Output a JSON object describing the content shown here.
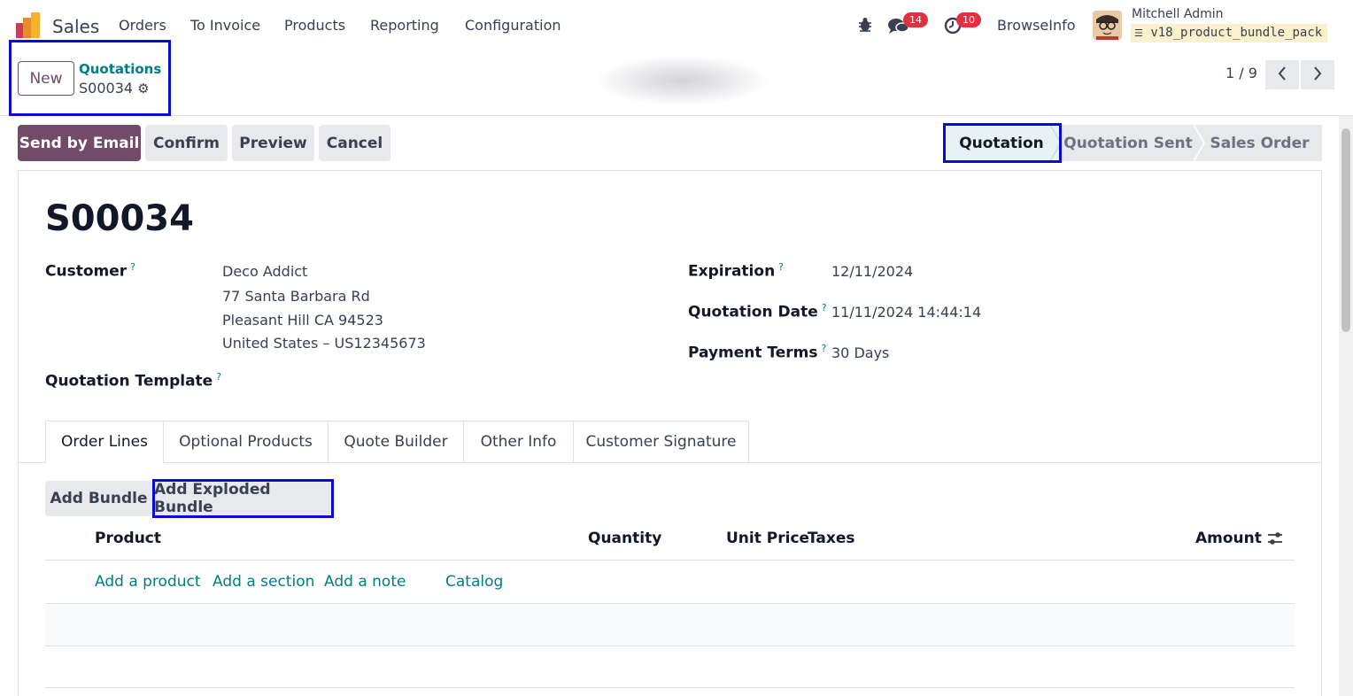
{
  "navbar": {
    "app_name": "Sales",
    "menus": [
      "Orders",
      "To Invoice",
      "Products",
      "Reporting",
      "Configuration"
    ],
    "messages_count": "14",
    "activities_count": "10",
    "company": "BrowseInfo",
    "user": "Mitchell Admin",
    "database": "v18_product_bundle_pack"
  },
  "control_panel": {
    "new_label": "New",
    "breadcrumb_parent": "Quotations",
    "breadcrumb_current": "S00034",
    "pager": "1 / 9"
  },
  "actions": {
    "send_email": "Send by Email",
    "confirm": "Confirm",
    "preview": "Preview",
    "cancel": "Cancel"
  },
  "statusbar": {
    "stages": [
      "Quotation",
      "Quotation Sent",
      "Sales Order"
    ],
    "active": "Quotation"
  },
  "form": {
    "title": "S00034",
    "customer_label": "Customer",
    "customer_lines": [
      "Deco Addict",
      "77 Santa Barbara Rd",
      "Pleasant Hill CA 94523",
      "United States – US12345673"
    ],
    "template_label": "Quotation Template",
    "expiration_label": "Expiration",
    "expiration_value": "12/11/2024",
    "quotation_date_label": "Quotation Date",
    "quotation_date_value": "11/11/2024 14:44:14",
    "payment_terms_label": "Payment Terms",
    "payment_terms_value": "30 Days",
    "help_mark": "?"
  },
  "tabs": [
    "Order Lines",
    "Optional Products",
    "Quote Builder",
    "Other Info",
    "Customer Signature"
  ],
  "bundle_buttons": {
    "add_bundle": "Add Bundle",
    "add_exploded_bundle": "Add Exploded Bundle"
  },
  "order_table": {
    "columns": [
      "Product",
      "Quantity",
      "Unit Price",
      "Taxes",
      "Amount"
    ],
    "links": [
      "Add a product",
      "Add a section",
      "Add a note",
      "Catalog"
    ]
  },
  "colors": {
    "brand": "#714b67",
    "link": "#017e84",
    "highlight": "#0a0ad8",
    "badge": "#e1303f"
  }
}
